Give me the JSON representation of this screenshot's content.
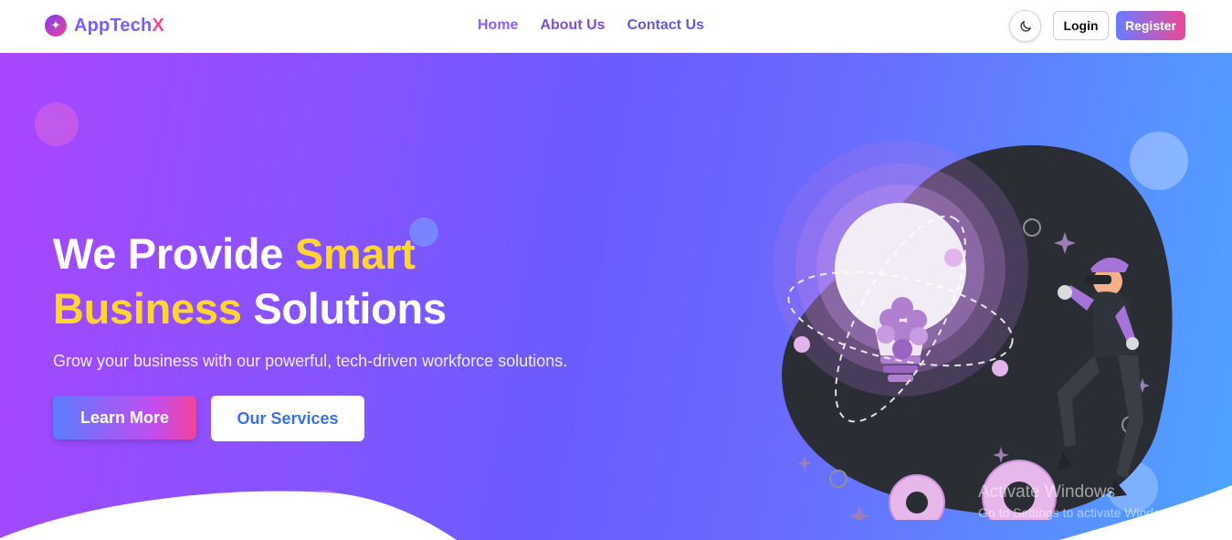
{
  "brand": {
    "name": "AppTech",
    "suffix": "X",
    "icon": "sparkle-icon"
  },
  "nav": {
    "links": [
      {
        "label": "Home"
      },
      {
        "label": "About Us"
      },
      {
        "label": "Contact Us"
      }
    ],
    "theme_toggle_icon": "moon-icon",
    "login_label": "Login",
    "register_label": "Register"
  },
  "hero": {
    "title_part1": "We Provide ",
    "title_highlight1": "Smart",
    "title_highlight2": "Business",
    "title_part2": " Solutions",
    "subtitle": "Grow your business with our powerful, tech-driven workforce solutions.",
    "learn_more_label": "Learn More",
    "services_label": "Our Services",
    "illustration": "lightbulb-vr-person-gears-illustration"
  },
  "watermark": {
    "title": "Activate Windows",
    "subtitle": "Go to Settings to activate Windows."
  },
  "colors": {
    "accent_purple": "#8b5cf6",
    "accent_pink": "#ec4899",
    "highlight_yellow": "#ffd52e",
    "hero_gradient_start": "#a946ff",
    "hero_gradient_end": "#4ea4ff"
  }
}
